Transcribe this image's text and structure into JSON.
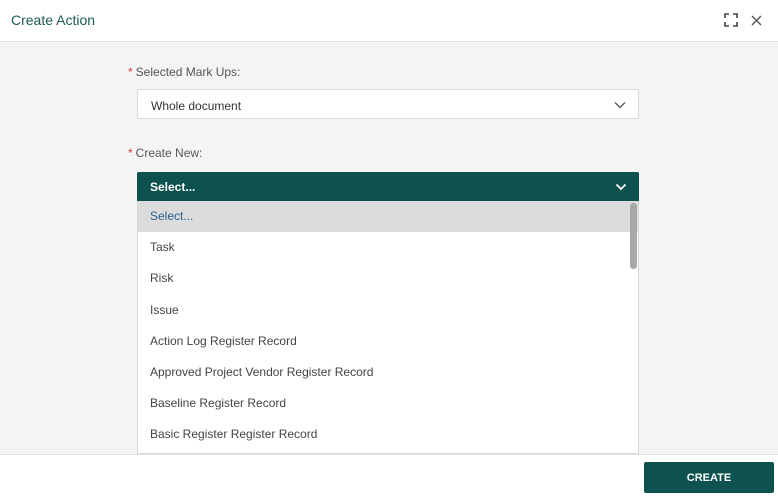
{
  "header": {
    "title": "Create Action"
  },
  "form": {
    "markups": {
      "required_mark": "*",
      "label": "Selected Mark Ups:",
      "value": "Whole document"
    },
    "create_new": {
      "required_mark": "*",
      "label": "Create New:",
      "value": "Select...",
      "options": [
        "Select...",
        "Task",
        "Risk",
        "Issue",
        "Action Log Register Record",
        "Approved Project Vendor Register Record",
        "Baseline Register Record",
        "Basic Register Register Record"
      ]
    }
  },
  "footer": {
    "create_label": "CREATE"
  },
  "colors": {
    "accent": "#0e524f",
    "required": "#d03c3c",
    "title": "#1d5a57"
  }
}
